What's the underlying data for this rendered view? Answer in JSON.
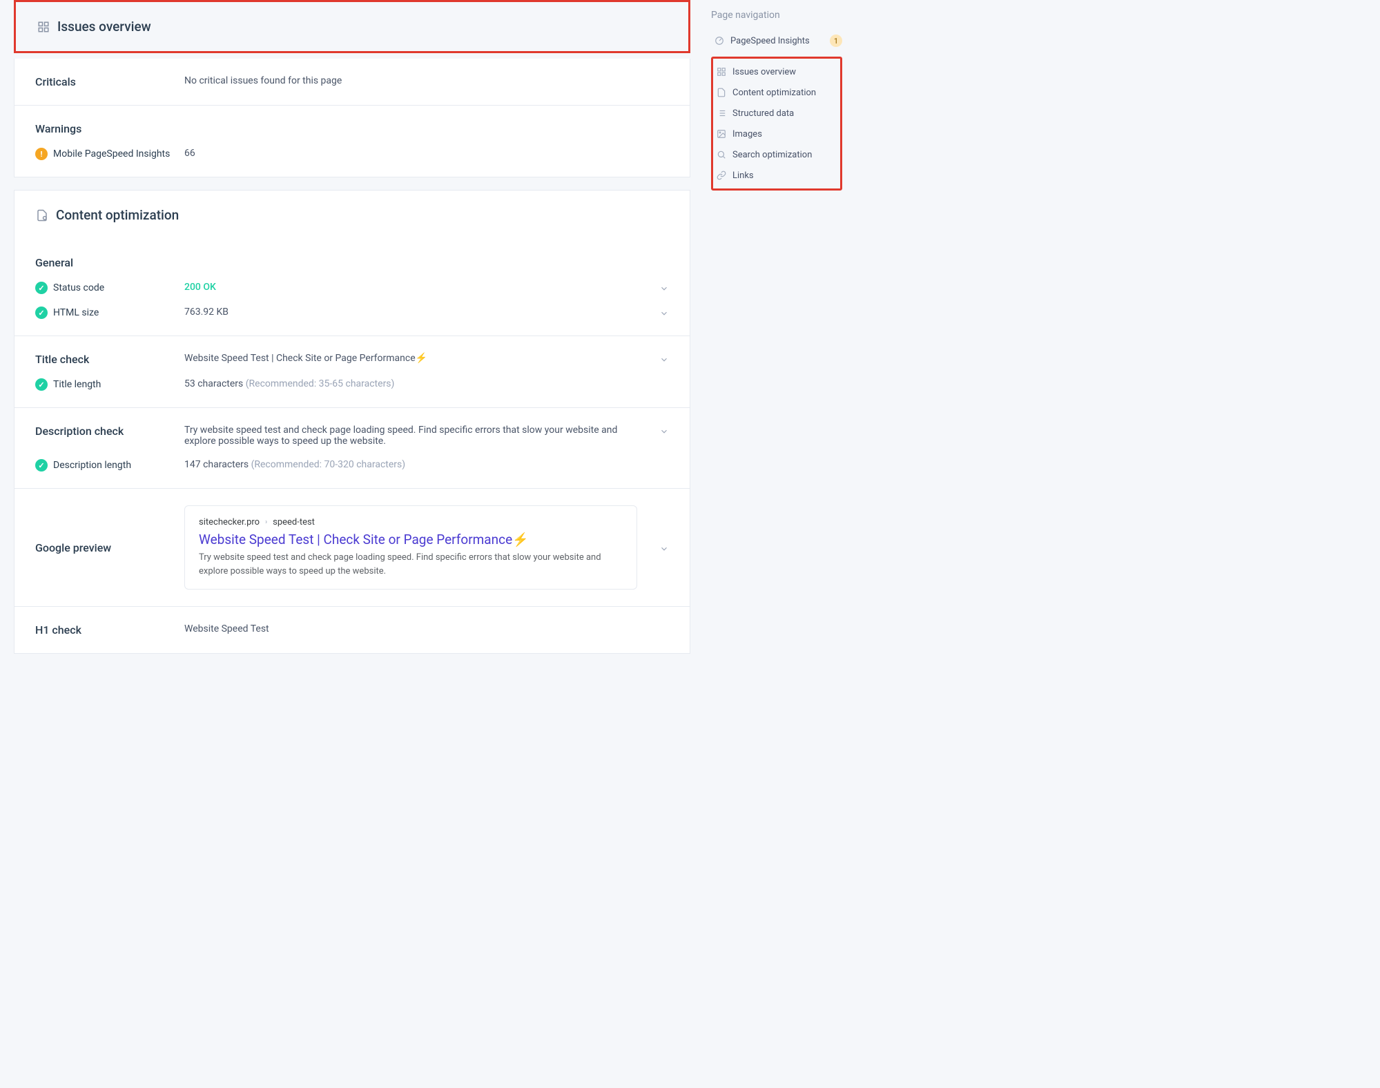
{
  "nav": {
    "heading": "Page navigation",
    "pagespeed": {
      "label": "PageSpeed Insights",
      "badge": "1"
    },
    "items": [
      {
        "label": "Issues overview",
        "icon": "grid"
      },
      {
        "label": "Content optimization",
        "icon": "content"
      },
      {
        "label": "Structured data",
        "icon": "list"
      },
      {
        "label": "Images",
        "icon": "image"
      },
      {
        "label": "Search optimization",
        "icon": "search"
      },
      {
        "label": "Links",
        "icon": "link"
      }
    ]
  },
  "issues_overview": {
    "title": "Issues overview",
    "criticals": {
      "label": "Criticals",
      "message": "No critical issues found for this page"
    },
    "warnings": {
      "label": "Warnings",
      "items": [
        {
          "label": "Mobile PageSpeed Insights",
          "value": "66"
        }
      ]
    }
  },
  "content_opt": {
    "title": "Content optimization",
    "general": {
      "label": "General",
      "status_code": {
        "label": "Status code",
        "value": "200 OK"
      },
      "html_size": {
        "label": "HTML size",
        "value": "763.92 KB"
      }
    },
    "title_check": {
      "label": "Title check",
      "value": "Website Speed Test | Check Site or Page Performance⚡",
      "length": {
        "label": "Title length",
        "value": "53 characters ",
        "hint": "(Recommended: 35-65 characters)"
      }
    },
    "desc_check": {
      "label": "Description check",
      "value": "Try website speed test and check page loading speed. Find specific errors that slow your website and explore possible ways to speed up the website.",
      "length": {
        "label": "Description length",
        "value": "147 characters ",
        "hint": "(Recommended: 70-320 characters)"
      }
    },
    "google_preview": {
      "label": "Google preview",
      "domain": "sitechecker.pro",
      "path": "speed-test",
      "title": "Website Speed Test | Check Site or Page Performance⚡",
      "desc": "Try website speed test and check page loading speed. Find specific errors that slow your website and explore possible ways to speed up the website."
    },
    "h1_check": {
      "label": "H1 check",
      "value": "Website Speed Test"
    }
  }
}
